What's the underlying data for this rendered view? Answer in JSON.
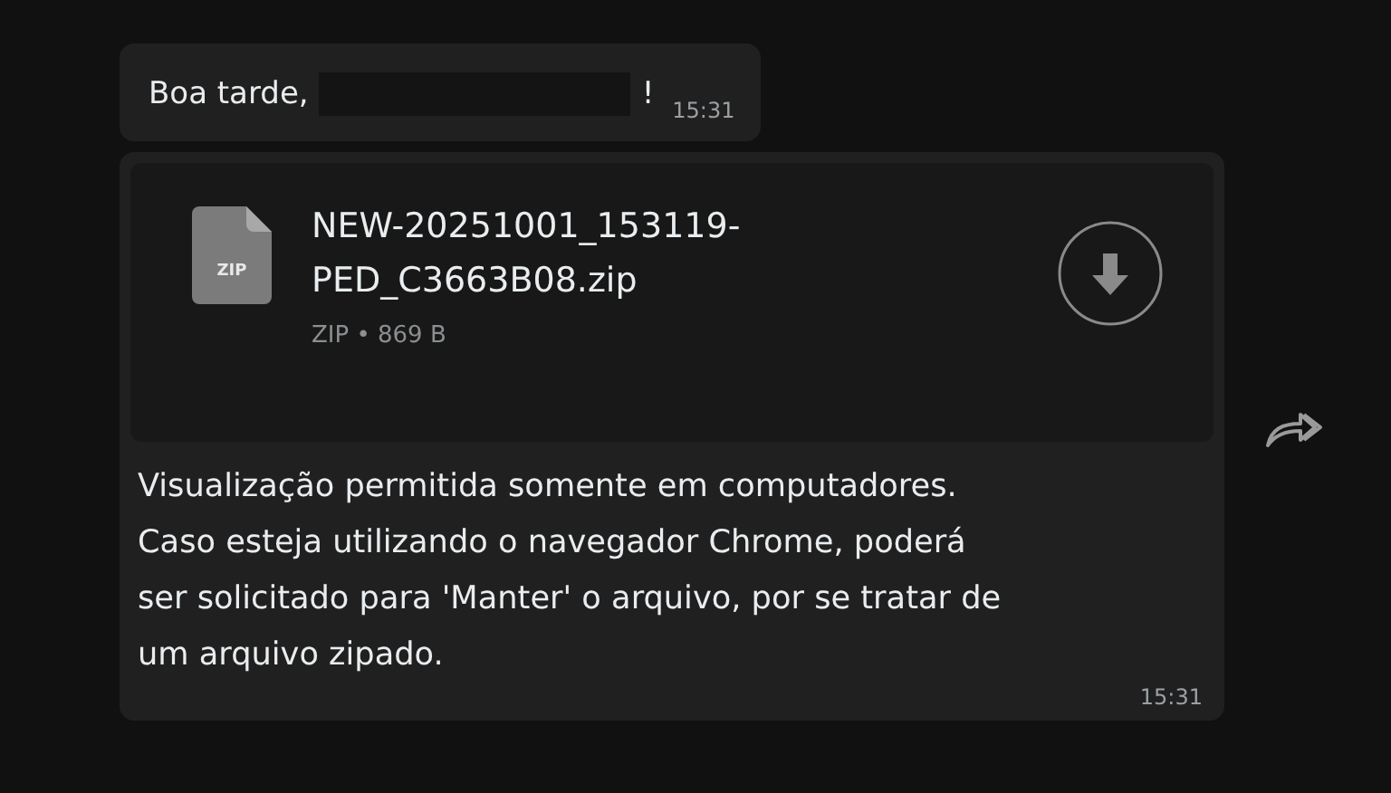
{
  "messages": [
    {
      "kind": "text",
      "text": "Boa tarde,",
      "redacted": true,
      "suffix": "!",
      "time": "15:31"
    },
    {
      "kind": "file",
      "file": {
        "name": "NEW-20251001_153119-PED_C3663B08.zip",
        "icon_label": "ZIP",
        "meta": "ZIP • 869 B"
      },
      "text": "Visualização permitida somente em computadores. Caso esteja utilizando o navegador Chrome, poderá ser solicitado para 'Manter' o arquivo, por se tratar de um arquivo zipado.",
      "time": "15:31",
      "forward": true
    }
  ]
}
